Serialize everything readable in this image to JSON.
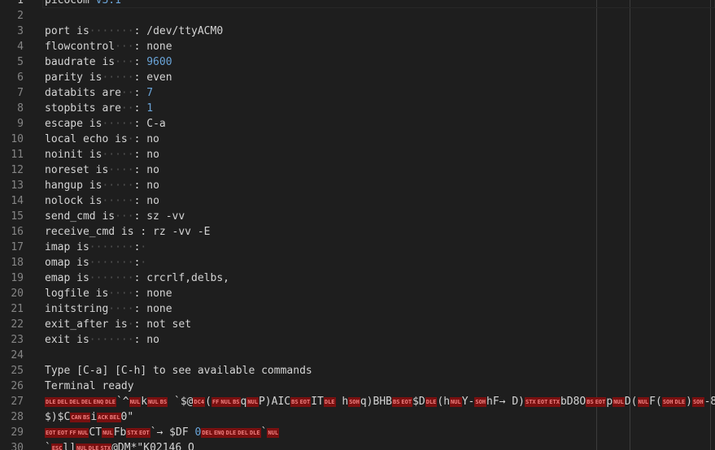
{
  "editor": {
    "lines": [
      {
        "n": "1",
        "parts": [
          {
            "t": "picocom "
          },
          {
            "t": "v3.1",
            "k": "num"
          }
        ]
      },
      {
        "n": "2",
        "parts": []
      },
      {
        "n": "3",
        "parts": [
          {
            "t": "port is"
          },
          {
            "t": "·······",
            "k": "ws"
          },
          {
            "t": ": /dev/ttyACM0"
          }
        ]
      },
      {
        "n": "4",
        "parts": [
          {
            "t": "flowcontrol"
          },
          {
            "t": "···",
            "k": "ws"
          },
          {
            "t": ": none"
          }
        ]
      },
      {
        "n": "5",
        "parts": [
          {
            "t": "baudrate is"
          },
          {
            "t": "···",
            "k": "ws"
          },
          {
            "t": ": "
          },
          {
            "t": "9600",
            "k": "num"
          }
        ]
      },
      {
        "n": "6",
        "parts": [
          {
            "t": "parity is"
          },
          {
            "t": "·····",
            "k": "ws"
          },
          {
            "t": ": even"
          }
        ]
      },
      {
        "n": "7",
        "parts": [
          {
            "t": "databits are"
          },
          {
            "t": "··",
            "k": "ws"
          },
          {
            "t": ": "
          },
          {
            "t": "7",
            "k": "num"
          }
        ]
      },
      {
        "n": "8",
        "parts": [
          {
            "t": "stopbits are"
          },
          {
            "t": "··",
            "k": "ws"
          },
          {
            "t": ": "
          },
          {
            "t": "1",
            "k": "num"
          }
        ]
      },
      {
        "n": "9",
        "parts": [
          {
            "t": "escape is"
          },
          {
            "t": "·····",
            "k": "ws"
          },
          {
            "t": ": C-a"
          }
        ]
      },
      {
        "n": "10",
        "parts": [
          {
            "t": "local echo is"
          },
          {
            "t": "·",
            "k": "ws"
          },
          {
            "t": ": no"
          }
        ]
      },
      {
        "n": "11",
        "parts": [
          {
            "t": "noinit is"
          },
          {
            "t": "·····",
            "k": "ws"
          },
          {
            "t": ": no"
          }
        ]
      },
      {
        "n": "12",
        "parts": [
          {
            "t": "noreset is"
          },
          {
            "t": "····",
            "k": "ws"
          },
          {
            "t": ": no"
          }
        ]
      },
      {
        "n": "13",
        "parts": [
          {
            "t": "hangup is"
          },
          {
            "t": "·····",
            "k": "ws"
          },
          {
            "t": ": no"
          }
        ]
      },
      {
        "n": "14",
        "parts": [
          {
            "t": "nolock is"
          },
          {
            "t": "·····",
            "k": "ws"
          },
          {
            "t": ": no"
          }
        ]
      },
      {
        "n": "15",
        "parts": [
          {
            "t": "send_cmd is"
          },
          {
            "t": "···",
            "k": "ws"
          },
          {
            "t": ": sz -vv"
          }
        ]
      },
      {
        "n": "16",
        "parts": [
          {
            "t": "receive_cmd is : rz -vv -E"
          }
        ]
      },
      {
        "n": "17",
        "parts": [
          {
            "t": "imap is"
          },
          {
            "t": "·······",
            "k": "ws"
          },
          {
            "t": ":"
          },
          {
            "t": "·",
            "k": "ws"
          }
        ]
      },
      {
        "n": "18",
        "parts": [
          {
            "t": "omap is"
          },
          {
            "t": "·······",
            "k": "ws"
          },
          {
            "t": ":"
          },
          {
            "t": "·",
            "k": "ws"
          }
        ]
      },
      {
        "n": "19",
        "parts": [
          {
            "t": "emap is"
          },
          {
            "t": "·······",
            "k": "ws"
          },
          {
            "t": ": crcrlf,delbs,"
          }
        ]
      },
      {
        "n": "20",
        "parts": [
          {
            "t": "logfile is"
          },
          {
            "t": "····",
            "k": "ws"
          },
          {
            "t": ": none"
          }
        ]
      },
      {
        "n": "21",
        "parts": [
          {
            "t": "initstring"
          },
          {
            "t": "····",
            "k": "ws"
          },
          {
            "t": ": none"
          }
        ]
      },
      {
        "n": "22",
        "parts": [
          {
            "t": "exit_after is"
          },
          {
            "t": "·",
            "k": "ws"
          },
          {
            "t": ": not set"
          }
        ]
      },
      {
        "n": "23",
        "parts": [
          {
            "t": "exit is"
          },
          {
            "t": "·······",
            "k": "ws"
          },
          {
            "t": ": no"
          }
        ]
      },
      {
        "n": "24",
        "parts": []
      },
      {
        "n": "25",
        "parts": [
          {
            "t": "Type [C-a] [C-h] to see available commands"
          }
        ]
      },
      {
        "n": "26",
        "parts": [
          {
            "t": "Terminal ready"
          }
        ]
      },
      {
        "n": "27",
        "parts": [
          {
            "t": "DLE",
            "k": "cc"
          },
          {
            "t": "DEL",
            "k": "cc"
          },
          {
            "t": "DEL",
            "k": "cc"
          },
          {
            "t": "DEL",
            "k": "cc"
          },
          {
            "t": "ENQ",
            "k": "cc"
          },
          {
            "t": "DLE",
            "k": "cc"
          },
          {
            "t": "`^"
          },
          {
            "t": "NUL",
            "k": "cc"
          },
          {
            "t": "k"
          },
          {
            "t": "NUL",
            "k": "cc"
          },
          {
            "t": "BS",
            "k": "cc"
          },
          {
            "t": " `$@"
          },
          {
            "t": "DC4",
            "k": "cc"
          },
          {
            "t": "("
          },
          {
            "t": "FF",
            "k": "cc"
          },
          {
            "t": "NUL",
            "k": "cc"
          },
          {
            "t": "BS",
            "k": "cc"
          },
          {
            "t": "q"
          },
          {
            "t": "NUL",
            "k": "cc"
          },
          {
            "t": "P)AIC"
          },
          {
            "t": "BS",
            "k": "cc"
          },
          {
            "t": "EOT",
            "k": "cc"
          },
          {
            "t": "IT"
          },
          {
            "t": "DLE",
            "k": "cc"
          },
          {
            "t": " h"
          },
          {
            "t": "SOH",
            "k": "cc"
          },
          {
            "t": "q)BHB"
          },
          {
            "t": "BS",
            "k": "cc"
          },
          {
            "t": "EOT",
            "k": "cc"
          },
          {
            "t": "$D"
          },
          {
            "t": "DLE",
            "k": "cc"
          },
          {
            "t": "(h"
          },
          {
            "t": "NUL",
            "k": "cc"
          },
          {
            "t": "Y-"
          },
          {
            "t": "SOH",
            "k": "cc"
          },
          {
            "t": "hF→ D)"
          },
          {
            "t": "STX",
            "k": "cc"
          },
          {
            "t": "EOT",
            "k": "cc"
          },
          {
            "t": "ETX",
            "k": "cc"
          },
          {
            "t": "bD8O"
          },
          {
            "t": "BS",
            "k": "cc"
          },
          {
            "t": "EOT",
            "k": "cc"
          },
          {
            "t": "p"
          },
          {
            "t": "NUL",
            "k": "cc"
          },
          {
            "t": "D("
          },
          {
            "t": "NUL",
            "k": "cc"
          },
          {
            "t": "F("
          },
          {
            "t": "SOH",
            "k": "cc"
          },
          {
            "t": "DLE",
            "k": "cc"
          },
          {
            "t": ")"
          },
          {
            "t": "SOH",
            "k": "cc"
          },
          {
            "t": "-8"
          }
        ]
      },
      {
        "n": "28",
        "parts": [
          {
            "t": "$)$C"
          },
          {
            "t": "CAN",
            "k": "cc"
          },
          {
            "t": "BS",
            "k": "cc"
          },
          {
            "t": "i"
          },
          {
            "t": "ACK",
            "k": "cc"
          },
          {
            "t": "BEL",
            "k": "cc"
          },
          {
            "t": "0\""
          }
        ]
      },
      {
        "n": "29",
        "parts": [
          {
            "t": "EOT",
            "k": "cc"
          },
          {
            "t": "EOT",
            "k": "cc"
          },
          {
            "t": "FF",
            "k": "cc"
          },
          {
            "t": "NUL",
            "k": "cc"
          },
          {
            "t": "CT"
          },
          {
            "t": "NUL",
            "k": "cc"
          },
          {
            "t": "Fb"
          },
          {
            "t": "STX",
            "k": "cc"
          },
          {
            "t": "EOT",
            "k": "cc"
          },
          {
            "t": "`→ $DF "
          },
          {
            "t": "0",
            "k": "num"
          },
          {
            "t": "DEL",
            "k": "cc"
          },
          {
            "t": "ENQ",
            "k": "cc"
          },
          {
            "t": "DLE",
            "k": "cc"
          },
          {
            "t": "DEL",
            "k": "cc"
          },
          {
            "t": "DLE",
            "k": "cc"
          },
          {
            "t": "`"
          },
          {
            "t": "NUL",
            "k": "cc"
          }
        ]
      },
      {
        "n": "30",
        "parts": [
          {
            "t": "`"
          },
          {
            "t": "ESC",
            "k": "cc"
          },
          {
            "t": "l]"
          },
          {
            "t": "NUL",
            "k": "cc"
          },
          {
            "t": "DLE",
            "k": "cc"
          },
          {
            "t": "STX",
            "k": "cc"
          },
          {
            "t": "@DM*\"K02146 O"
          }
        ]
      }
    ]
  }
}
